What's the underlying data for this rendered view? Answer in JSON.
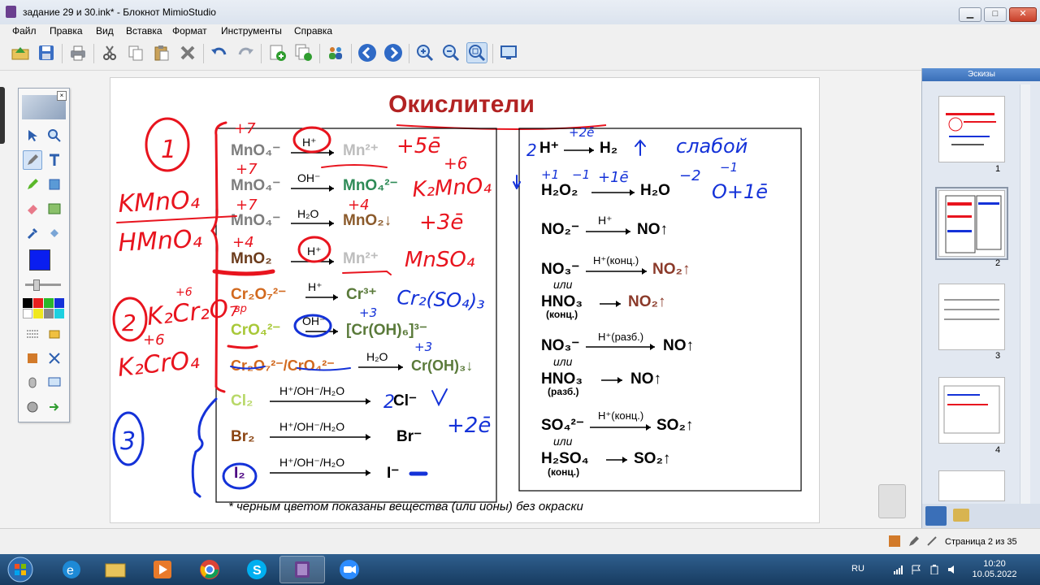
{
  "window": {
    "title": "задание 29 и 30.ink* - Блокнот MimioStudio",
    "minimize": "▁",
    "maximize": "□",
    "close": "✕"
  },
  "menu": [
    "Файл",
    "Правка",
    "Вид",
    "Вставка",
    "Формат",
    "Инструменты",
    "Справка"
  ],
  "toolbar_icons": [
    "open-icon",
    "save-icon",
    "print-icon",
    "cut-icon",
    "copy-icon",
    "paste-icon",
    "delete-icon",
    "undo-icon",
    "redo-icon",
    "new-page-icon",
    "duplicate-page-icon",
    "users-icon",
    "back-icon",
    "forward-icon",
    "zoom-in-icon",
    "zoom-out-icon",
    "zoom-fit-icon",
    "screen-icon"
  ],
  "slide": {
    "title": "Окислители",
    "footnote": "* черным цветом показаны вещества (или ионы) без окраски",
    "left_rows": [
      {
        "from": "MnO₄⁻",
        "cond": "H⁺",
        "to": "Mn²⁺",
        "from_color": "#7d7d7d",
        "to_color": "#bdbdbd"
      },
      {
        "from": "MnO₄⁻",
        "cond": "OH⁻",
        "to": "MnO₄²⁻",
        "from_color": "#7d7d7d",
        "to_color": "#2e8b57"
      },
      {
        "from": "MnO₄⁻",
        "cond": "H₂O",
        "to": "MnO₂↓",
        "from_color": "#7d7d7d",
        "to_color": "#8b5a2b"
      },
      {
        "from": "MnO₂",
        "cond": "H⁺",
        "to": "Mn²⁺",
        "from_color": "#6b3b1b",
        "to_color": "#bdbdbd"
      },
      {
        "from": "Cr₂O₇²⁻",
        "cond": "H⁺",
        "to": "Cr³⁺",
        "from_color": "#d2691e",
        "to_color": "#5a7a3a"
      },
      {
        "from": "CrO₄²⁻",
        "cond": "OH⁻",
        "to": "[Cr(OH)₆]³⁻",
        "from_color": "#a8c838",
        "to_color": "#5a7a3a"
      },
      {
        "from": "Cr₂O₇²⁻/CrO₄²⁻",
        "cond": "H₂O",
        "to": "Cr(OH)₃↓",
        "from_color": "#d2691e",
        "to_color": "#5a7a3a"
      },
      {
        "from": "Cl₂",
        "cond": "H⁺/OH⁻/H₂O",
        "to": "Cl⁻",
        "from_color": "#b8d868",
        "to_color": "#000000"
      },
      {
        "from": "Br₂",
        "cond": "H⁺/OH⁻/H₂O",
        "to": "Br⁻",
        "from_color": "#8b4513",
        "to_color": "#000000"
      },
      {
        "from": "I₂",
        "cond": "H⁺/OH⁻/H₂O",
        "to": "I⁻",
        "from_color": "#4b0082",
        "to_color": "#000000"
      }
    ],
    "right_rows": [
      {
        "from": "H⁺",
        "cond": "",
        "to": "H₂",
        "to_color": "#000000"
      },
      {
        "from": "H₂O₂",
        "cond": "",
        "to": "H₂O",
        "to_color": "#000000"
      },
      {
        "from": "NO₂⁻",
        "cond": "H⁺",
        "to": "NO↑",
        "to_color": "#000000"
      },
      {
        "from": "NO₃⁻",
        "cond": "H⁺(конц.)",
        "to": "NO₂↑",
        "to_color": "#8b3a2a"
      },
      {
        "from": "HNO₃",
        "sub": "(конц.)",
        "cond": "",
        "to": "NO₂↑",
        "to_color": "#8b3a2a"
      },
      {
        "from": "NO₃⁻",
        "cond": "H⁺(разб.)",
        "to": "NO↑",
        "to_color": "#000000"
      },
      {
        "from": "HNO₃",
        "sub": "(разб.)",
        "cond": "",
        "to": "NO↑",
        "to_color": "#000000"
      },
      {
        "from": "SO₄²⁻",
        "cond": "H⁺(конц.)",
        "to": "SO₂↑",
        "to_color": "#000000"
      },
      {
        "from": "H₂SO₄",
        "sub": "(конц.)",
        "cond": "",
        "to": "SO₂↑",
        "to_color": "#000000"
      }
    ],
    "ili": "или",
    "handwriting": {
      "red": [
        "1",
        "KMnO₄",
        "HMnO₄",
        "2",
        "K₂Cr₂O₇",
        "K₂CrO₄",
        "+7",
        "+7",
        "+7",
        "+4",
        "+5ē",
        "+6",
        "K₂MnO₄",
        "+4",
        "+3ē",
        "MnSO₄",
        "+6",
        "+6",
        "вр"
      ],
      "blue": [
        "3",
        "Cr₂(SO₄)₃",
        "+3",
        "+3",
        "+2ē",
        "слабой",
        "+1",
        "−1",
        "+1ē",
        "−2",
        "−1",
        "O+1ē",
        "+2ē",
        "2",
        "2"
      ]
    }
  },
  "thumbnails": {
    "header": "Эскизы",
    "items": [
      {
        "num": "1",
        "selected": false
      },
      {
        "num": "2",
        "selected": true
      },
      {
        "num": "3",
        "selected": false
      },
      {
        "num": "4",
        "selected": false
      }
    ]
  },
  "status": {
    "page": "Страница 2 из 35"
  },
  "taskbar": {
    "apps": [
      "ie-icon",
      "explorer-icon",
      "media-icon",
      "chrome-icon",
      "skype-icon",
      "mimio-icon",
      "zoom-icon"
    ],
    "lang": "RU",
    "time": "10:20",
    "date": "10.05.2022"
  },
  "colors": {
    "red_ink": "#e8141e",
    "blue_ink": "#1432d8",
    "title_red": "#b22222"
  }
}
